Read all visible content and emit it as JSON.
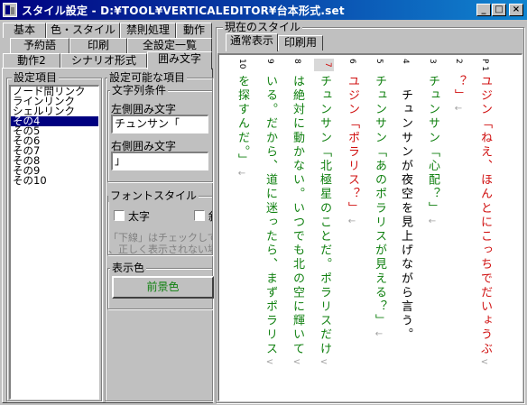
{
  "window": {
    "title": "スタイル設定 - D:¥TOOL¥VERTICALEDITOR¥台本形式.set",
    "minimize_label": "_",
    "maximize_label": "□",
    "close_label": "×"
  },
  "tabs": {
    "row1": [
      "基本",
      "色・スタイル",
      "禁則処理",
      "動作"
    ],
    "row2": [
      "予約語",
      "印刷",
      "全設定一覧"
    ],
    "row3": [
      "動作2",
      "シナリオ形式",
      "囲み文字"
    ],
    "active": "囲み文字"
  },
  "settings_list": {
    "title": "設定項目",
    "items": [
      "ノード間リンク",
      "ラインリンク",
      "シェルリンク",
      "その4",
      "その5",
      "その6",
      "その7",
      "その8",
      "その9",
      "その10"
    ],
    "selected_index": 3
  },
  "configurable": {
    "title": "設定可能な項目",
    "string_group_title": "文字列条件",
    "left_label": "左側囲み文字",
    "left_value": "チュンサン「",
    "right_label": "右側囲み文字",
    "right_value": "」",
    "font_group_title": "フォントスタイル",
    "bold_label": "太字",
    "second_checkbox_label": "斜",
    "hint_line1": "「下線」はチェックしても",
    "hint_line2": "、正しく表示されない場",
    "display_color_title": "表示色",
    "foreground_button": "前景色"
  },
  "current_style": {
    "title": "現在のスタイル",
    "tabs": [
      "通常表示",
      "印刷用"
    ],
    "active_tab": "通常表示"
  },
  "preview": {
    "columns": [
      {
        "num": "P 1",
        "text": "ユジン「ねえ、ほんとにこっちでだいょうぶ",
        "color": "#d01010",
        "arrow": "<"
      },
      {
        "num": "2",
        "text": "？」",
        "color": "#d01010",
        "arrow": "←"
      },
      {
        "num": "3",
        "text": "チュンサン「心配？」",
        "color": "#108010",
        "arrow": "←"
      },
      {
        "num": "4",
        "text": "　チュンサンが夜空を見上げながら言う。",
        "color": "#000000",
        "arrow": ""
      },
      {
        "num": "5",
        "text": "チュンサン「あのポラリスが見える？」",
        "color": "#108010",
        "arrow": "←"
      },
      {
        "num": "6",
        "text": "ユジン「ポラリス？」",
        "color": "#d01010",
        "arrow": "←"
      },
      {
        "num": "7",
        "text": "チュンサン「北極星のことだ。ポラリスだけ",
        "color": "#108010",
        "arrow": "<"
      },
      {
        "num": "8",
        "text": "は絶対に動かない。いつでも北の空に輝いて",
        "color": "#108010",
        "arrow": "<"
      },
      {
        "num": "9",
        "text": "いる。だから、道に迷ったら、まずポラリス",
        "color": "#108010",
        "arrow": "<"
      },
      {
        "num": "10",
        "text": "を探すんだ。」",
        "color": "#108010",
        "arrow": "←"
      }
    ],
    "highlighted_line": "7"
  },
  "colors": {
    "title_bar": "#000080",
    "red_text": "#d01010",
    "green_text": "#108010",
    "selection": "#000080"
  }
}
